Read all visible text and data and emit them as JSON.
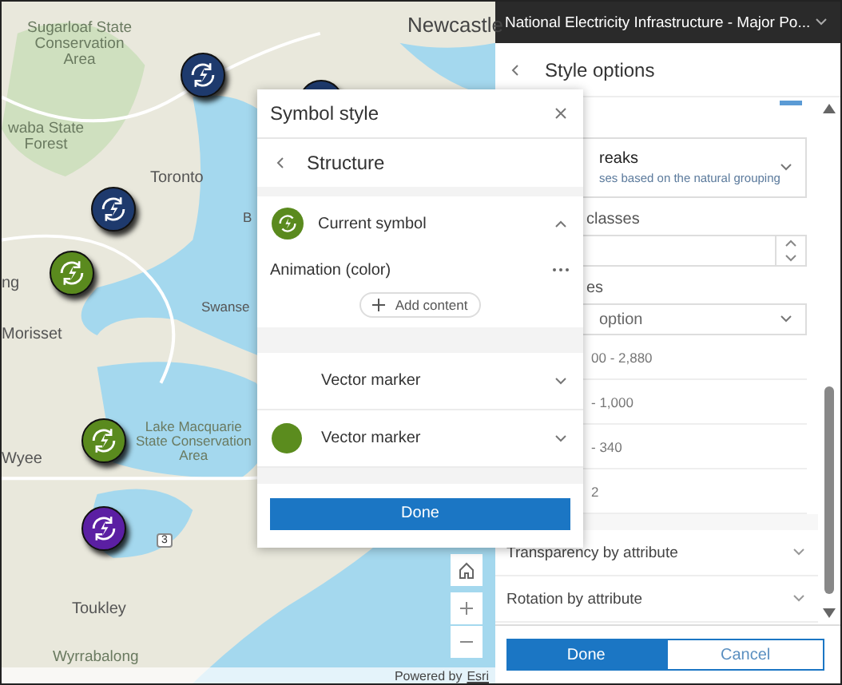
{
  "map": {
    "labels": [
      {
        "text": "Sugarloaf State\nConservation\nArea",
        "kind": "park"
      },
      {
        "text": "Newcastle",
        "kind": "city"
      },
      {
        "text": "waba State\nForest",
        "kind": "park"
      },
      {
        "text": "Toronto",
        "kind": "town"
      },
      {
        "text": "B",
        "kind": "town"
      },
      {
        "text": "ng",
        "kind": "town"
      },
      {
        "text": "Swanse",
        "kind": "town"
      },
      {
        "text": "Morisset",
        "kind": "town"
      },
      {
        "text": "Wyee",
        "kind": "town"
      },
      {
        "text": "Lake Macquarie\nState Conservation\nArea",
        "kind": "park"
      },
      {
        "text": "Toukley",
        "kind": "town"
      },
      {
        "text": "Wyrrabalong",
        "kind": "park"
      },
      {
        "text": "3",
        "kind": "road"
      }
    ],
    "markers": [
      {
        "color": "#1e3a6d"
      },
      {
        "color": "#1e3a6d"
      },
      {
        "color": "#1e3a6d"
      },
      {
        "color": "#5a8a1e"
      },
      {
        "color": "#5a8a1e"
      },
      {
        "color": "#5b1fa3"
      }
    ],
    "attribution": {
      "prefix": "Powered by",
      "link": "Esri"
    }
  },
  "panel": {
    "title": "National Electricity Infrastructure - Major Po...",
    "subtitle": "Style options",
    "method": {
      "title": "reaks",
      "description": "ses based on the natural grouping"
    },
    "classes_label": "classes",
    "options_label": "es",
    "option_value": "option",
    "ranges": [
      "00 - 2,880",
      "- 1,000",
      "- 340",
      "2"
    ],
    "sections": [
      {
        "label": "Transparency by attribute",
        "expanded": false
      },
      {
        "label": "Rotation by attribute",
        "expanded": false
      }
    ],
    "buttons": [
      {
        "label": "Done",
        "primary": true
      },
      {
        "label": "Cancel",
        "primary": false
      }
    ]
  },
  "dialog": {
    "title": "Symbol style",
    "subtitle": "Structure",
    "current": {
      "label": "Current symbol",
      "color": "#5a8a1e",
      "expanded": true
    },
    "layer_name": "Animation (color)",
    "add_label": "Add content",
    "layers": [
      {
        "label": "Vector marker",
        "kind": "plain",
        "expanded": false
      },
      {
        "label": "Vector marker",
        "kind": "swatch",
        "color": "#5b8c1e",
        "expanded": false
      }
    ],
    "done": "Done"
  }
}
